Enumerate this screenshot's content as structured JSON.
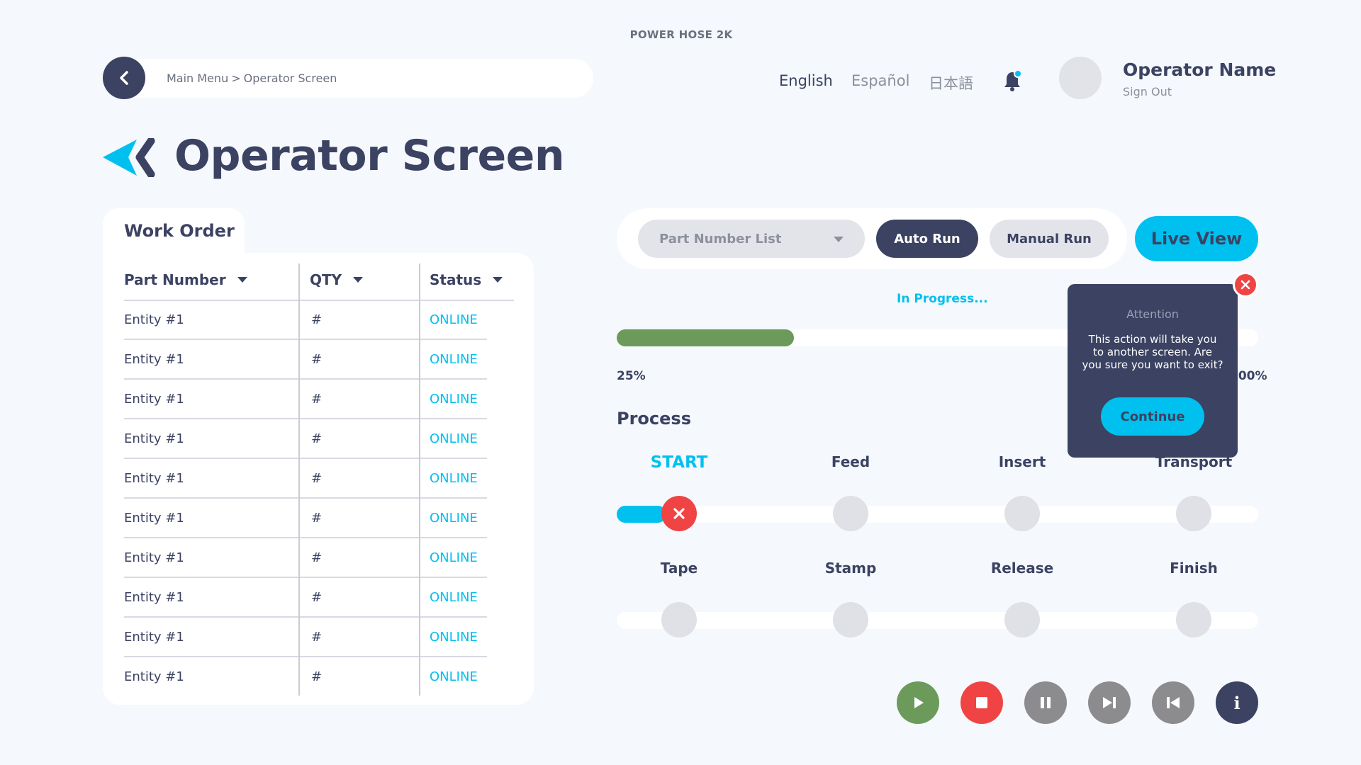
{
  "app": {
    "title": "POWER HOSE 2K"
  },
  "breadcrumb": {
    "items": [
      "Main Menu",
      "Operator Screen"
    ],
    "separator": ">"
  },
  "languages": [
    "English",
    "Español",
    "日本語"
  ],
  "user": {
    "name": "Operator Name",
    "sign_out": "Sign Out"
  },
  "page": {
    "title": "Operator Screen"
  },
  "work_order": {
    "title": "Work Order",
    "columns": [
      "Part Number",
      "QTY",
      "Status"
    ],
    "rows": [
      [
        "Entity #1",
        "#",
        "ONLINE"
      ],
      [
        "Entity #1",
        "#",
        "ONLINE"
      ],
      [
        "Entity #1",
        "#",
        "ONLINE"
      ],
      [
        "Entity #1",
        "#",
        "ONLINE"
      ],
      [
        "Entity #1",
        "#",
        "ONLINE"
      ],
      [
        "Entity #1",
        "#",
        "ONLINE"
      ],
      [
        "Entity #1",
        "#",
        "ONLINE"
      ],
      [
        "Entity #1",
        "#",
        "ONLINE"
      ],
      [
        "Entity #1",
        "#",
        "ONLINE"
      ],
      [
        "Entity #1",
        "#",
        "ONLINE"
      ]
    ]
  },
  "controls": {
    "part_number_placeholder": "Part Number List",
    "auto_run": "Auto Run",
    "manual_run": "Manual Run",
    "live_view": "Live View"
  },
  "progress": {
    "status": "In Progress...",
    "value": 0.25,
    "left_label": "25%",
    "right_label": "100%"
  },
  "process": {
    "title": "Process",
    "steps": [
      "START",
      "Feed",
      "Insert",
      "Transport",
      "Tape",
      "Stamp",
      "Release",
      "Finish"
    ],
    "active_step": "START",
    "error_step": "START"
  },
  "modal": {
    "heading": "Attention",
    "message": "This action will take you to another screen. Are you sure you want to exit?",
    "button": "Continue"
  },
  "media_controls": [
    "play-icon",
    "stop-icon",
    "pause-icon",
    "skip-next-icon",
    "skip-previous-icon",
    "info-icon"
  ],
  "info_glyph": "i",
  "colors": {
    "primary": "#3b4262",
    "accent": "#00c0ef",
    "success": "#6b9a5a",
    "danger": "#f04444",
    "muted": "#8c8c8e",
    "background": "#f5f8fc"
  }
}
